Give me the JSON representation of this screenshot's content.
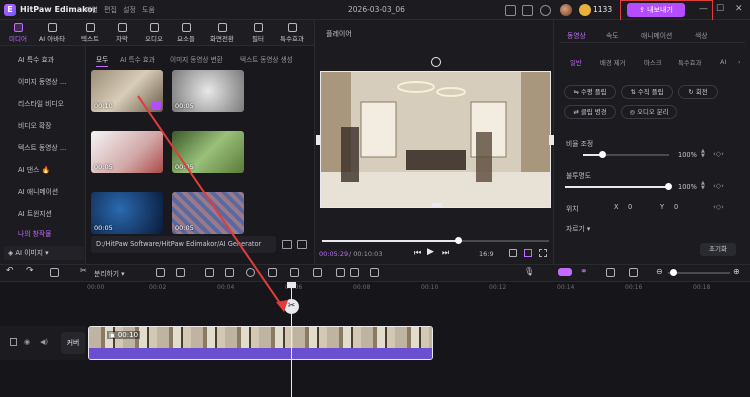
{
  "titlebar": {
    "app_name": "HitPaw Edimakor",
    "menu": [
      "파일",
      "편집",
      "설정",
      "도움"
    ],
    "project_title": "2026-03-03_06",
    "credits": "1133",
    "export_label": "내보내기",
    "window_controls": [
      "—",
      "☐",
      "✕"
    ]
  },
  "tools": [
    {
      "label": "미디어",
      "icon": "media-icon",
      "active": true
    },
    {
      "label": "AI 아바타",
      "icon": "ai-avatar-icon"
    },
    {
      "label": "텍스트",
      "icon": "text-icon"
    },
    {
      "label": "자막",
      "icon": "subtitle-icon"
    },
    {
      "label": "오디오",
      "icon": "audio-icon"
    },
    {
      "label": "요소들",
      "icon": "elements-icon"
    },
    {
      "label": "화면전환",
      "icon": "transition-icon"
    },
    {
      "label": "필터",
      "icon": "filter-icon"
    },
    {
      "label": "특수효과",
      "icon": "effects-icon"
    }
  ],
  "sidebar": {
    "items": [
      {
        "label": "AI 특수 효과"
      },
      {
        "label": "이미지 동영상 ..."
      },
      {
        "label": "리스타일 비디오"
      },
      {
        "label": "비디오 확장"
      },
      {
        "label": "텍스트 동영상 ..."
      },
      {
        "label": "AI 댄스 🔥"
      },
      {
        "label": "AI 애니메이션"
      },
      {
        "label": "AI 트윈지션"
      },
      {
        "label": "나의 창작물",
        "active": true
      }
    ],
    "model_select": "AI 이미지"
  },
  "media": {
    "subtabs": [
      "모두",
      "AI 특수 효과",
      "이미지 동영상 변환",
      "텍스트 동영상 생성"
    ],
    "thumbnails": [
      {
        "duration": "00:10",
        "badge": true
      },
      {
        "duration": "00:05"
      },
      {
        "duration": "00:05"
      },
      {
        "duration": "00:05"
      },
      {
        "duration": "00:05"
      },
      {
        "duration": "00:05"
      }
    ],
    "path": "D:/HitPaw Software/HitPaw Edimakor/AI Generator"
  },
  "player": {
    "label": "플레이어",
    "time_current": "00:05:29",
    "time_total": "/ 00:10:03",
    "ratio": "16:9",
    "progress": 0.6
  },
  "rpanel": {
    "tabs": [
      "동영상",
      "속도",
      "애니메이션",
      "색상"
    ],
    "subtabs": [
      "일반",
      "배경 제거",
      "마스크",
      "특수효과",
      "AI"
    ],
    "buttons_row1": [
      "수평 플립",
      "수직 플립",
      "회전"
    ],
    "buttons_row2": [
      "클립 병경",
      "오디오 분리"
    ],
    "scale_label": "비율 조정",
    "scale_value": "100%",
    "scale_fraction": 0.22,
    "opacity_label": "불투명도",
    "opacity_value": "100%",
    "opacity_fraction": 1.0,
    "position_label": "위치",
    "x_label": "X",
    "x_value": "0",
    "y_label": "Y",
    "y_value": "0",
    "autosave_label": "자르기 ▾",
    "reset_label": "초기화"
  },
  "timeline": {
    "split_label": "분리하기 ▾",
    "ticks": [
      "00:00",
      "00:02",
      "00:04",
      "00:06",
      "00:08",
      "00:10",
      "00:12",
      "00:14",
      "00:16",
      "00:18"
    ],
    "cover_label": "커버",
    "clip_duration": "00:10"
  },
  "colors": {
    "accent": "#c36bff",
    "export": "#b54dff",
    "highlight_box": "#e23b3b"
  }
}
